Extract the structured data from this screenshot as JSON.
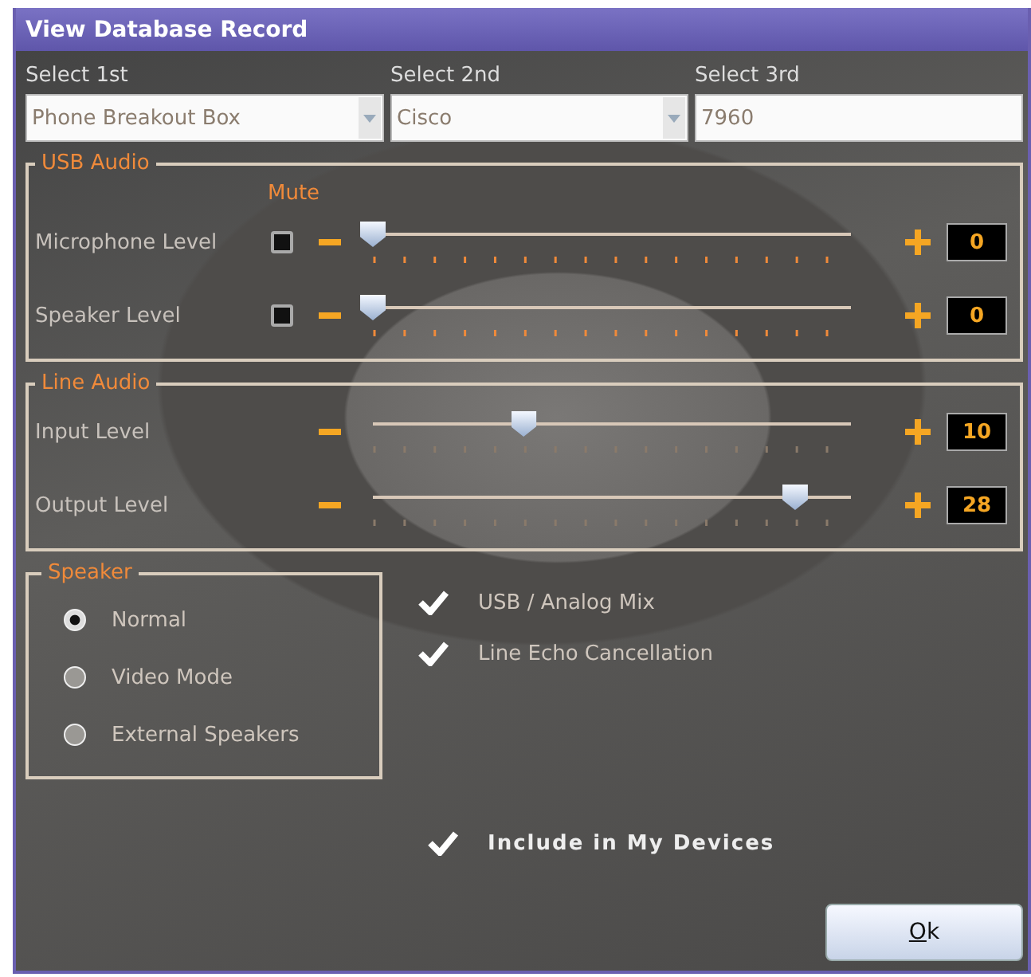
{
  "window": {
    "title": "View Database Record"
  },
  "selects": [
    {
      "label": "Select 1st",
      "value": "Phone Breakout Box",
      "kind": "dropdown"
    },
    {
      "label": "Select 2nd",
      "value": "Cisco",
      "kind": "dropdown"
    },
    {
      "label": "Select 3rd",
      "value": "7960",
      "kind": "text"
    }
  ],
  "usb_audio": {
    "title": "USB Audio",
    "mute_heading": "Mute",
    "channels": [
      {
        "name": "Microphone Level",
        "muted": false,
        "level": 0,
        "reading": "0"
      },
      {
        "name": "Speaker Level",
        "muted": false,
        "level": 0,
        "reading": "0"
      }
    ]
  },
  "line_audio": {
    "title": "Line Audio",
    "channels": [
      {
        "name": "Input Level",
        "level": 0.333,
        "reading": "10"
      },
      {
        "name": "Output Level",
        "level": 0.933,
        "reading": "28"
      }
    ]
  },
  "speaker": {
    "title": "Speaker",
    "options": [
      {
        "label": "Normal",
        "selected": true
      },
      {
        "label": "Video Mode",
        "selected": false
      },
      {
        "label": "External Speakers",
        "selected": false
      }
    ]
  },
  "options": [
    {
      "label": "USB / Analog Mix",
      "checked": true
    },
    {
      "label": "Line Echo Cancellation",
      "checked": true
    }
  ],
  "include": {
    "label": "Include in My Devices",
    "checked": true
  },
  "ok_button": {
    "label": "Ok"
  }
}
